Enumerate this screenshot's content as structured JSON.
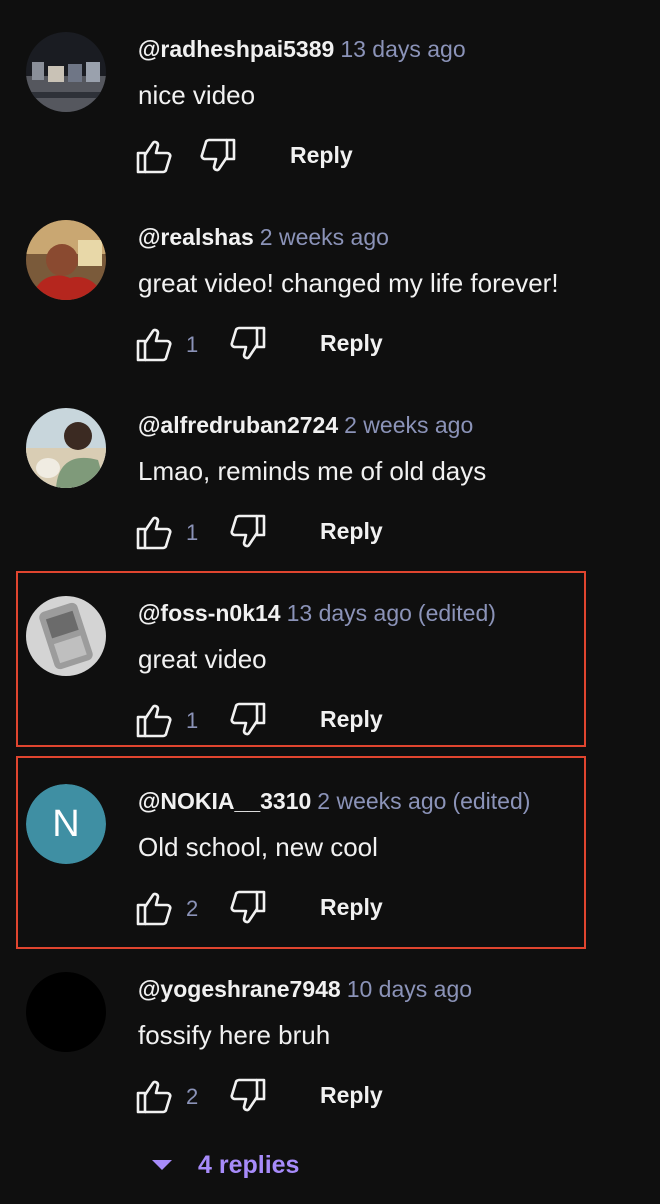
{
  "comments": [
    {
      "author": "@radheshpai5389",
      "time": "13 days ago",
      "edited": "",
      "text": "nice video",
      "likes": "",
      "reply_label": "Reply",
      "avatar": "photo-night-crowd"
    },
    {
      "author": "@realshas",
      "time": "2 weeks ago",
      "edited": "",
      "text": "great video! changed my life forever!",
      "likes": "1",
      "reply_label": "Reply",
      "avatar": "photo-person-red"
    },
    {
      "author": "@alfredruban2724",
      "time": "2 weeks ago",
      "edited": "",
      "text": "Lmao, reminds me of old days",
      "likes": "1",
      "reply_label": "Reply",
      "avatar": "photo-person-dog"
    },
    {
      "author": "@foss-n0k14",
      "time": "13 days ago",
      "edited": "(edited)",
      "text": "great video",
      "likes": "1",
      "reply_label": "Reply",
      "avatar": "photo-phone"
    },
    {
      "author": "@NOKIA__3310",
      "time": "2 weeks ago",
      "edited": "(edited)",
      "text": "Old school, new cool",
      "likes": "2",
      "reply_label": "Reply",
      "avatar": "letter",
      "avatar_letter": "N",
      "avatar_color": "#3f8fa3"
    },
    {
      "author": "@yogeshrane7948",
      "time": "10 days ago",
      "edited": "",
      "text": "fossify here bruh",
      "likes": "2",
      "reply_label": "Reply",
      "avatar": "black"
    }
  ],
  "replies_toggle": {
    "label": "4 replies",
    "icon": "caret-down-icon"
  },
  "colors": {
    "background": "#0f0f0f",
    "highlight": "#e0452f",
    "muted": "#8b93b8",
    "replies": "#a78bfa"
  }
}
